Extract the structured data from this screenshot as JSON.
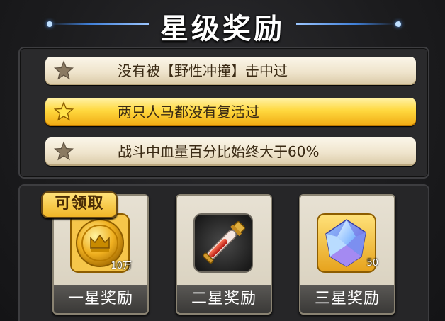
{
  "title": "星级奖励",
  "conditions": [
    {
      "text": "没有被【野性冲撞】击中过",
      "state": "inactive"
    },
    {
      "text": "两只人马都没有复活过",
      "state": "active"
    },
    {
      "text": "战斗中血量百分比始终大于60%",
      "state": "inactive"
    }
  ],
  "rewards": [
    {
      "label": "一星奖励",
      "quantity": "10万",
      "icon": "gold-coin-icon"
    },
    {
      "label": "二星奖励",
      "quantity": "",
      "icon": "potion-vial-icon"
    },
    {
      "label": "三星奖励",
      "quantity": "50",
      "icon": "crystal-gem-icon"
    }
  ],
  "claim_badge": "可领取",
  "colors": {
    "accent_blue": "#3f7fd8",
    "active_row": "#ffd83e",
    "inactive_row": "#efe4cc",
    "badge": "#f0b627"
  }
}
